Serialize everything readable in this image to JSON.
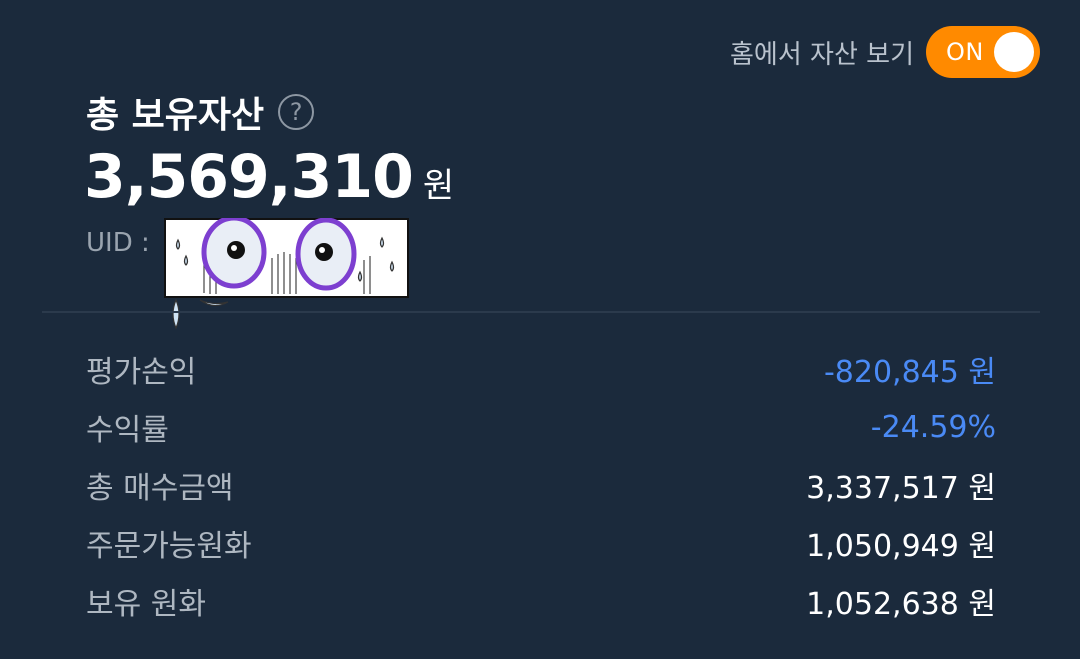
{
  "header": {
    "home_toggle_label": "홈에서 자산 보기",
    "home_toggle_state": "ON"
  },
  "summary": {
    "title": "총 보유자산",
    "help_icon": "question-icon",
    "total_value": "3,569,310",
    "total_unit": "원",
    "uid_label": "UID :"
  },
  "details": {
    "rows": [
      {
        "label": "평가손익",
        "value": "-820,845 원",
        "tone": "negative"
      },
      {
        "label": "수익률",
        "value": "-24.59%",
        "tone": "negative"
      },
      {
        "label": "총 매수금액",
        "value": "3,337,517 원",
        "tone": "normal"
      },
      {
        "label": "주문가능원화",
        "value": "1,050,949 원",
        "tone": "normal"
      },
      {
        "label": "보유 원화",
        "value": "1,052,638 원",
        "tone": "normal"
      }
    ]
  },
  "colors": {
    "background": "#1b2a3c",
    "accent_toggle": "#ff8a00",
    "negative": "#4a8af5"
  }
}
